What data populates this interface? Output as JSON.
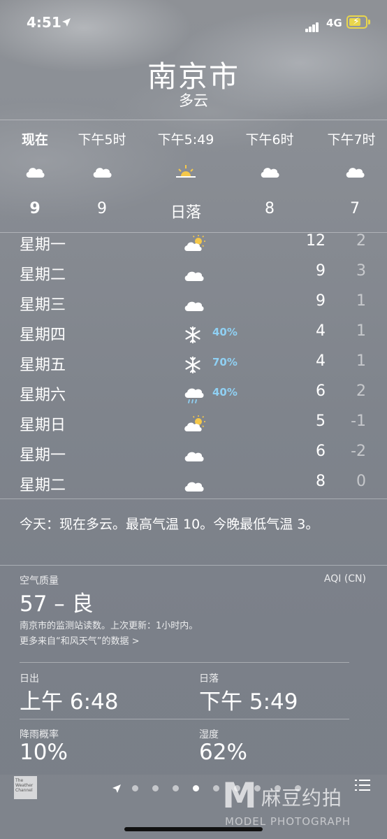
{
  "status_bar": {
    "time": "4:51",
    "network": "4G",
    "battery_color": "#e9d64c"
  },
  "location": {
    "city": "南京市",
    "condition": "多云"
  },
  "hourly": [
    {
      "label": "现在",
      "icon": "cloud-icon",
      "temp": "9",
      "bold": true
    },
    {
      "label": "下午5时",
      "icon": "cloud-icon",
      "temp": "9"
    },
    {
      "label": "下午5:49",
      "icon": "sunset-icon",
      "temp": "日落"
    },
    {
      "label": "下午6时",
      "icon": "cloud-icon",
      "temp": "8"
    },
    {
      "label": "下午7时",
      "icon": "cloud-icon",
      "temp": "7"
    }
  ],
  "daily": [
    {
      "day": "星期一",
      "icon": "partly-sunny-icon",
      "prob": "",
      "high": "12",
      "low": "2"
    },
    {
      "day": "星期二",
      "icon": "cloud-icon",
      "prob": "",
      "high": "9",
      "low": "3"
    },
    {
      "day": "星期三",
      "icon": "cloud-icon",
      "prob": "",
      "high": "9",
      "low": "1"
    },
    {
      "day": "星期四",
      "icon": "snow-icon",
      "prob": "40%",
      "high": "4",
      "low": "1"
    },
    {
      "day": "星期五",
      "icon": "snow-icon",
      "prob": "70%",
      "high": "4",
      "low": "1"
    },
    {
      "day": "星期六",
      "icon": "rain-icon",
      "prob": "40%",
      "high": "6",
      "low": "2"
    },
    {
      "day": "星期日",
      "icon": "partly-sunny-icon",
      "prob": "",
      "high": "5",
      "low": "-1"
    },
    {
      "day": "星期一",
      "icon": "cloud-icon",
      "prob": "",
      "high": "6",
      "low": "-2"
    },
    {
      "day": "星期二",
      "icon": "cloud-icon",
      "prob": "",
      "high": "8",
      "low": "0"
    }
  ],
  "summary": "今天：现在多云。最高气温 10。今晚最低气温 3。",
  "air_quality": {
    "label": "空气质量",
    "unit": "AQI (CN)",
    "value": "57 – 良",
    "description": "南京市的监测站读数。上次更新：1小时内。",
    "more_link": "更多来自“和风天气”的数据 >"
  },
  "details": {
    "sunrise_label": "日出",
    "sunrise_value": "上午 6:48",
    "sunset_label": "日落",
    "sunset_value": "下午 5:49",
    "rain_label": "降雨概率",
    "rain_value": "10%",
    "humidity_label": "湿度",
    "humidity_value": "62%"
  },
  "bottom_bar": {
    "logo_text": "The Weather Channel",
    "page_count": 9,
    "active_page": 3
  },
  "watermark": {
    "cn": "麻豆约拍",
    "en": "MODEL PHOTOGRAPH"
  },
  "colors": {
    "precip_blue": "#8fd0f3",
    "sun_yellow": "#f5c84a"
  }
}
